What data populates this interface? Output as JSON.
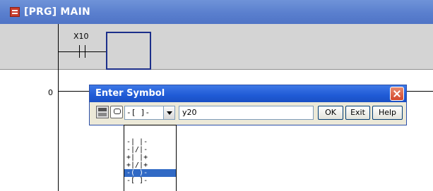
{
  "window": {
    "title": "[PRG] MAIN"
  },
  "ladder": {
    "contact_label": "X10",
    "step_number": "0"
  },
  "dialog": {
    "title": "Enter Symbol",
    "instruction_select_value": "-[ ]-",
    "symbol_input_value": "y20",
    "buttons": {
      "ok": "OK",
      "exit": "Exit",
      "help": "Help"
    }
  },
  "dropdown": {
    "items": [
      {
        "label": "-| |-",
        "selected": false
      },
      {
        "label": "-|/|-",
        "selected": false
      },
      {
        "label": "+| |+",
        "selected": false
      },
      {
        "label": "+|/|+",
        "selected": false
      },
      {
        "label": "-( )-",
        "selected": true
      },
      {
        "label": "-[ ]-",
        "selected": false
      }
    ]
  },
  "colors": {
    "window_title_bg": "#5a7fce",
    "dialog_title_bg": "#1f5ad6",
    "selection": "#316ac5"
  }
}
